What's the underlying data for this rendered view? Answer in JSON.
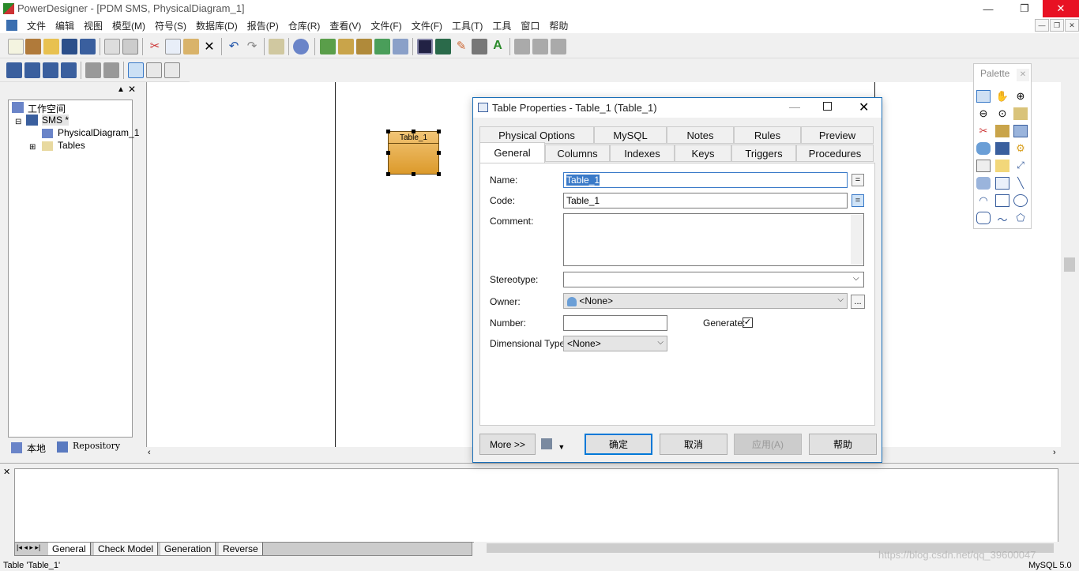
{
  "app": {
    "title": "PowerDesigner - [PDM SMS, PhysicalDiagram_1]",
    "win_min": "—",
    "win_max": "❐",
    "win_close": "✕"
  },
  "menu": [
    "文件",
    "编辑",
    "视图",
    "模型(M)",
    "符号(S)",
    "数据库(D)",
    "报告(P)",
    "仓库(R)",
    "查看(V)",
    "文件(F)",
    "文件(F)",
    "工具(T)",
    "工具",
    "窗口",
    "帮助"
  ],
  "mdi_controls": [
    "—",
    "❐",
    "✕"
  ],
  "tree": {
    "workspace": "工作空间",
    "model": "SMS *",
    "diagram": "PhysicalDiagram_1",
    "tables": "Tables"
  },
  "left_tabs": {
    "local": "本地",
    "repository": "Repository"
  },
  "diagram": {
    "table_name": "Table_1"
  },
  "palette": {
    "title": "Palette"
  },
  "dialog": {
    "title": "Table Properties - Table_1 (Table_1)",
    "tabs_row1": [
      "Physical Options",
      "MySQL",
      "Notes",
      "Rules",
      "Preview"
    ],
    "tabs_row2": [
      "General",
      "Columns",
      "Indexes",
      "Keys",
      "Triggers",
      "Procedures"
    ],
    "active_tab": "General",
    "fields": {
      "name_label": "Name:",
      "name_value": "Table_1",
      "code_label": "Code:",
      "code_value": "Table_1",
      "comment_label": "Comment:",
      "comment_value": "",
      "stereotype_label": "Stereotype:",
      "stereotype_value": "",
      "owner_label": "Owner:",
      "owner_value": "<None>",
      "number_label": "Number:",
      "number_value": "",
      "generate_label": "Generate:",
      "generate_checked": true,
      "dimtype_label": "Dimensional Type:",
      "dimtype_value": "<None>"
    },
    "buttons": {
      "more": "More >>",
      "ok": "确定",
      "cancel": "取消",
      "apply": "应用(A)",
      "help": "帮助"
    }
  },
  "output_tabs": [
    "General",
    "Check Model",
    "Generation",
    "Reverse"
  ],
  "status": {
    "left": "Table 'Table_1'",
    "right": "MySQL 5.0"
  },
  "watermark": "https://blog.csdn.net/qq_39600047",
  "colors": {
    "entity_fill": "#e4a84a",
    "dialog_border": "#1a6fb8",
    "close_red": "#e81123"
  }
}
